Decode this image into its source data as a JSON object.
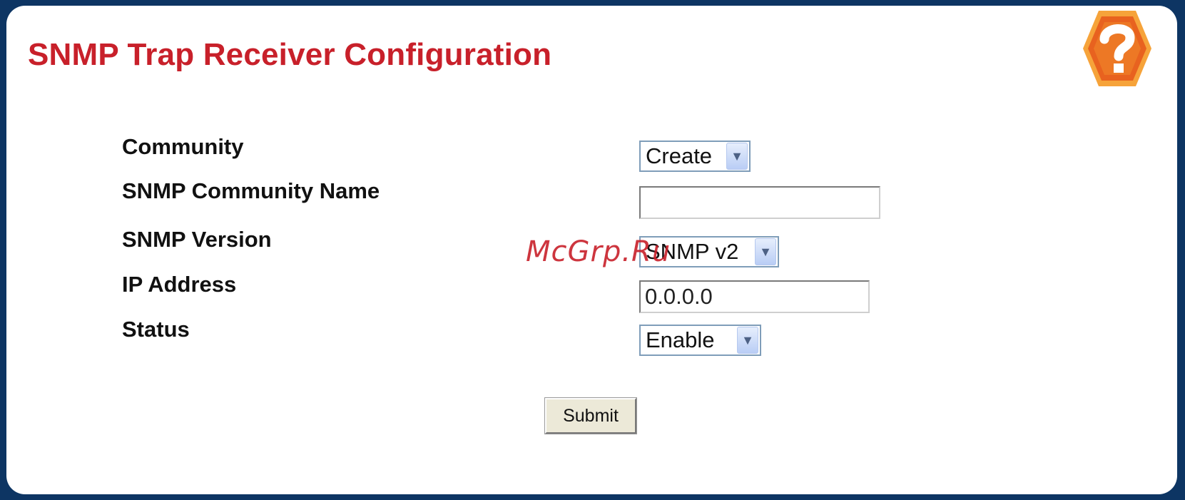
{
  "page": {
    "title": "SNMP Trap Receiver Configuration",
    "help_icon": "help-question-icon"
  },
  "form": {
    "community": {
      "label": "Community",
      "selected": "Create"
    },
    "community_name": {
      "label": "SNMP Community Name",
      "value": ""
    },
    "snmp_version": {
      "label": "SNMP Version",
      "selected": "SNMP v2"
    },
    "ip_address": {
      "label": "IP Address",
      "value": "0.0.0.0"
    },
    "status": {
      "label": "Status",
      "selected": "Enable"
    },
    "submit_label": "Submit"
  },
  "watermark": "McGrp.Ru",
  "colors": {
    "frame": "#0d3563",
    "title": "#c8202a",
    "help_outer": "#f28c28",
    "help_inner": "#e85a1e"
  }
}
